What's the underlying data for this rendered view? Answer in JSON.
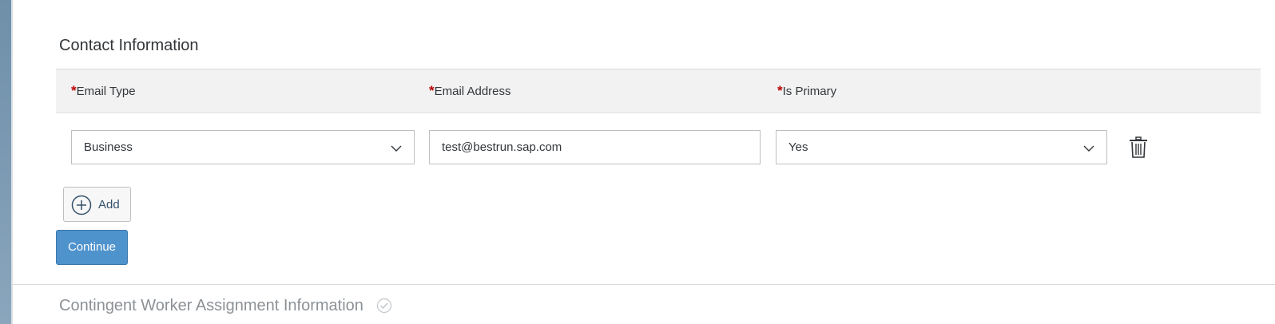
{
  "section": {
    "title": "Contact Information"
  },
  "columns": {
    "email_type": {
      "required_mark": "*",
      "label": "Email Type"
    },
    "email_address": {
      "required_mark": "*",
      "label": "Email Address"
    },
    "is_primary": {
      "required_mark": "*",
      "label": "Is Primary"
    }
  },
  "row": {
    "email_type_value": "Business",
    "email_address_value": "test@bestrun.sap.com",
    "is_primary_value": "Yes"
  },
  "buttons": {
    "add_label": "Add",
    "continue_label": "Continue"
  },
  "next_section": {
    "title": "Contingent Worker Assignment Information"
  },
  "icons": {
    "dropdown": "chevron-down-icon",
    "delete": "trash-icon",
    "add": "plus-circle-icon",
    "completed": "check-circle-icon"
  },
  "colors": {
    "primary_button": "#4f93cd",
    "required": "#bb0000",
    "side_strip": "#7d9bb3"
  }
}
